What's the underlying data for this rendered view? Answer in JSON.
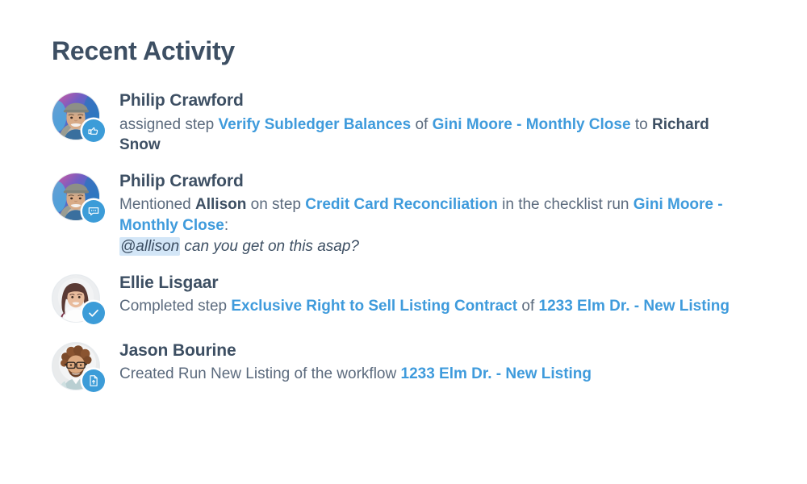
{
  "page": {
    "title": "Recent Activity",
    "accent_color": "#3f9bdc",
    "heading_color": "#3d4f63",
    "body_text_color": "#5b6a7d",
    "mention_highlight_color": "#d3e6f7",
    "badge_color": "#3c9cd8",
    "background_color": "#ffffff"
  },
  "activities": [
    {
      "actor": "Philip Crawford",
      "badge_icon": "pointing-hand-icon",
      "avatar": "philip-crawford-avatar",
      "tokens": [
        {
          "text": "assigned step ",
          "style": "plain"
        },
        {
          "text": "Verify Subledger Balances",
          "style": "link"
        },
        {
          "text": " of ",
          "style": "plain"
        },
        {
          "text": "Gini Moore - Monthly Close",
          "style": "link"
        },
        {
          "text": " to ",
          "style": "plain"
        },
        {
          "text": "Richard Snow",
          "style": "strong"
        }
      ],
      "quote": null
    },
    {
      "actor": "Philip Crawford",
      "badge_icon": "comment-bubble-icon",
      "avatar": "philip-crawford-avatar",
      "tokens": [
        {
          "text": "Mentioned ",
          "style": "plain"
        },
        {
          "text": "Allison",
          "style": "strong"
        },
        {
          "text": " on step ",
          "style": "plain"
        },
        {
          "text": "Credit Card Reconciliation",
          "style": "link"
        },
        {
          "text": " in the checklist run ",
          "style": "plain"
        },
        {
          "text": "Gini Moore - Monthly Close",
          "style": "link"
        },
        {
          "text": ":",
          "style": "plain"
        }
      ],
      "quote": {
        "mention": "@allison",
        "rest": " can you get on this asap?"
      }
    },
    {
      "actor": "Ellie Lisgaar",
      "badge_icon": "check-icon",
      "avatar": "ellie-lisgaar-avatar",
      "tokens": [
        {
          "text": "Completed step ",
          "style": "plain"
        },
        {
          "text": "Exclusive Right to Sell Listing Contract",
          "style": "link"
        },
        {
          "text": " of ",
          "style": "plain"
        },
        {
          "text": "1233 Elm Dr. - New Listing",
          "style": "link"
        }
      ],
      "quote": null
    },
    {
      "actor": "Jason Bourine",
      "badge_icon": "document-upload-icon",
      "avatar": "jason-bourine-avatar",
      "tokens": [
        {
          "text": "Created Run New Listing of the workflow ",
          "style": "plain"
        },
        {
          "text": "1233 Elm Dr. - New Listing",
          "style": "link"
        }
      ],
      "quote": null
    }
  ]
}
